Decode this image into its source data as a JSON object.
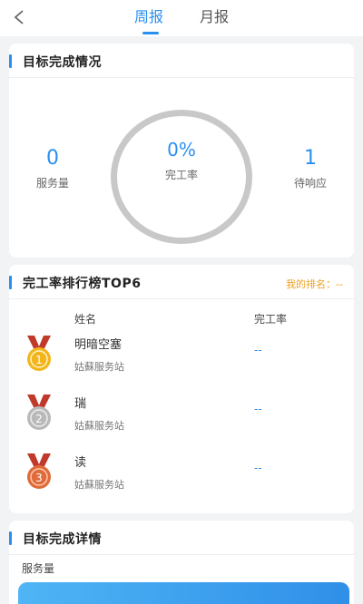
{
  "header": {
    "back_icon": "chevron-left-icon",
    "tabs": [
      {
        "label": "周报",
        "active": true
      },
      {
        "label": "月报",
        "active": false
      }
    ]
  },
  "target_card": {
    "title": "目标完成情况",
    "service_count": {
      "value": "0",
      "label": "服务量"
    },
    "completion": {
      "value": "0%",
      "label": "完工率"
    },
    "pending": {
      "value": "1",
      "label": "待响应"
    }
  },
  "ranking_card": {
    "title": "完工率排行榜TOP6",
    "my_rank": "我的排名：--",
    "columns": [
      "姓名",
      "完工率"
    ],
    "rows": [
      {
        "rank": "1",
        "name": "明暗空塞",
        "station": "姑蘇服务站",
        "rate": "--",
        "medal": "gold-medal-icon"
      },
      {
        "rank": "2",
        "name": "瑞",
        "station": "姑蘇服务站",
        "rate": "--",
        "medal": "silver-medal-icon"
      },
      {
        "rank": "3",
        "name": "读",
        "station": "姑蘇服务站",
        "rate": "--",
        "medal": "bronze-medal-icon"
      }
    ]
  },
  "detail_card": {
    "title": "目标完成详情",
    "sub_label": "服务量"
  },
  "colors": {
    "accent": "#2a8ff0",
    "rank_highlight": "#f0a020",
    "gold": "#f2b51c",
    "silver": "#b9b9b9",
    "bronze": "#e06a3a",
    "ribbon": "#c0392b"
  }
}
